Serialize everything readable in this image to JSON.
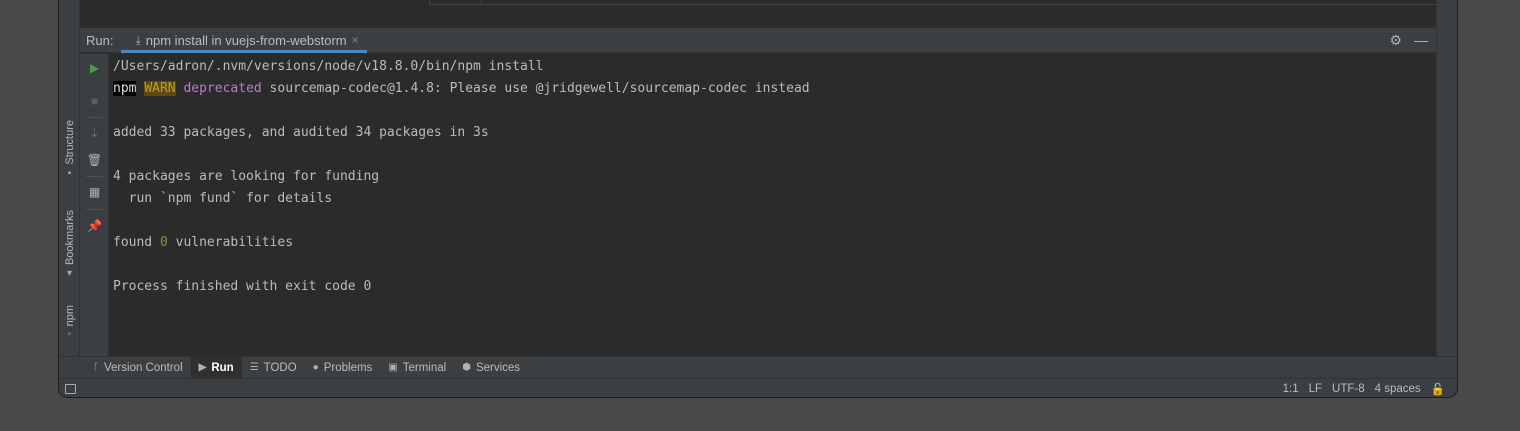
{
  "left_strip": {
    "tabs": [
      {
        "label": "Structure",
        "icon": "structure-icon"
      },
      {
        "label": "Bookmarks",
        "icon": "bookmark-icon"
      },
      {
        "label": "npm",
        "icon": "npm-icon"
      }
    ]
  },
  "run_panel": {
    "label": "Run:",
    "tab_label": "npm install in vuejs-from-webstorm",
    "tab_icon": "install-icon",
    "close_icon": "close-icon",
    "actions": [
      "settings-gear-icon",
      "minimize-icon"
    ]
  },
  "toolbar": {
    "buttons": [
      "rerun-icon",
      "stop-icon",
      "scroll-to-end-icon",
      "clear-trash-icon",
      "layout-icon",
      "pin-icon"
    ]
  },
  "console": {
    "line1": "/Users/adron/.nvm/versions/node/v18.8.0/bin/npm install",
    "line2_npm": "npm",
    "line2_warn": "WARN",
    "line2_deprecated": "deprecated",
    "line2_rest": " sourcemap-codec@1.4.8: Please use @jridgewell/sourcemap-codec instead",
    "line3": "added 33 packages, and audited 34 packages in 3s",
    "line4": "4 packages are looking for funding",
    "line5": "  run `npm fund` for details",
    "line6_pre": "found ",
    "line6_num": "0",
    "line6_post": " vulnerabilities",
    "line7": "Process finished with exit code 0"
  },
  "bottom_bar": {
    "items": [
      {
        "label": "Version Control",
        "icon": "branch-icon"
      },
      {
        "label": "Run",
        "icon": "run-play-icon",
        "active": true
      },
      {
        "label": "TODO",
        "icon": "list-icon"
      },
      {
        "label": "Problems",
        "icon": "info-icon"
      },
      {
        "label": "Terminal",
        "icon": "terminal-icon"
      },
      {
        "label": "Services",
        "icon": "services-icon"
      }
    ]
  },
  "status_bar": {
    "position": "1:1",
    "line_separator": "LF",
    "encoding": "UTF-8",
    "indent": "4 spaces",
    "lock_icon": "lock-icon"
  },
  "colors": {
    "accent": "#4a88c7",
    "run_green": "#499c54",
    "warn_bg": "#5c4a12",
    "deprecated": "#c077d0",
    "zero_green": "#6e9e3a"
  }
}
